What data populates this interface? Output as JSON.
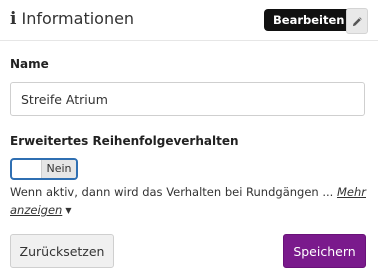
{
  "header": {
    "icon": "info-icon",
    "title": "Informationen",
    "edit_tooltip": "Bearbeiten",
    "edit_icon": "pencil-icon"
  },
  "name_field": {
    "label": "Name",
    "value": "Streife Atrium"
  },
  "order_setting": {
    "label": "Erweitertes Reihenfolgeverhalten",
    "toggle_state": "Nein",
    "description": "Wenn aktiv, dann wird das Verhalten bei Rundgängen ...",
    "more_link": "Mehr anzeigen"
  },
  "actions": {
    "reset_label": "Zurücksetzen",
    "save_label": "Speichern"
  },
  "colors": {
    "primary": "#7a1a8c",
    "toggle_border": "#2f6fb2",
    "tooltip_bg": "#111111"
  }
}
